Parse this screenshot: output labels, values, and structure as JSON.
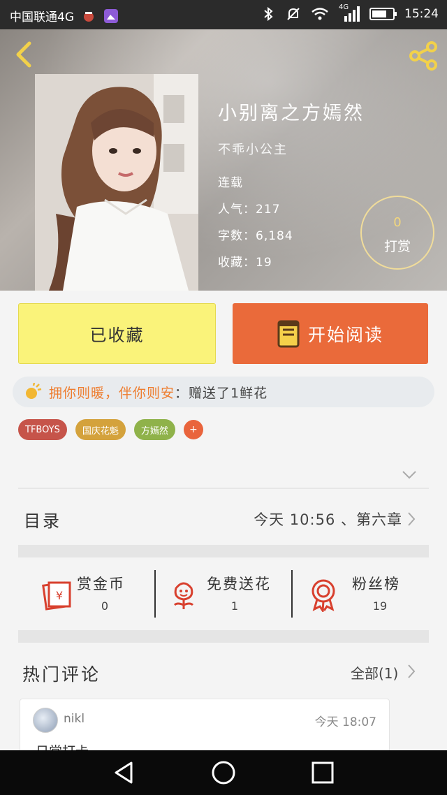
{
  "status_bar": {
    "carrier": "中国联通4G",
    "network_badge": "4G",
    "time": "15:24",
    "battery_level": 0.7,
    "icons": [
      "app-icon",
      "gallery-icon",
      "bluetooth-icon",
      "mute-icon",
      "wifi-icon",
      "signal-icon",
      "battery-icon"
    ]
  },
  "book": {
    "title": "小别离之方嫣然",
    "author": "不乖小公主",
    "status": "连载",
    "popularity": "人气：217",
    "word_count": "字数：6,184",
    "favorites": "收藏：19",
    "reward_count": "0",
    "reward_label": "打赏"
  },
  "actions": {
    "collected_label": "已收藏",
    "read_label": "开始阅读"
  },
  "gift": {
    "user": "拥你则暖，伴你则安",
    "message": "：赠送了1鲜花"
  },
  "tags": [
    {
      "label": "TFBOYS",
      "color": "#c6544a"
    },
    {
      "label": "国庆花魁",
      "color": "#d4a23c"
    },
    {
      "label": "方嫣然",
      "color": "#8fb24a"
    }
  ],
  "tag_add_label": "+",
  "catalog": {
    "label": "目录",
    "latest": "今天 10:56 、第六章"
  },
  "stats": [
    {
      "label": "赏金币",
      "value": "0",
      "icon": "red-envelope-icon"
    },
    {
      "label": "免费送花",
      "value": "1",
      "icon": "flower-icon"
    },
    {
      "label": "粉丝榜",
      "value": "19",
      "icon": "medal-icon"
    }
  ],
  "comments": {
    "title": "热门评论",
    "all_label": "全部(1)",
    "items": [
      {
        "user": "nikl",
        "time": "今天 18:07",
        "text": "日常打卡"
      }
    ]
  },
  "colors": {
    "accent_orange": "#ea6a3a",
    "collected_yellow": "#faf37a",
    "gift_orange": "#ee7d2f",
    "icon_red": "#d8402e"
  }
}
